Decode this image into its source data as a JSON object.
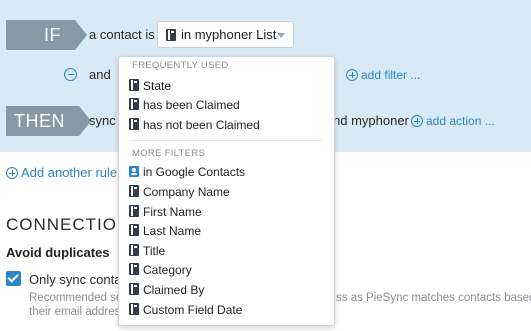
{
  "rules": {
    "if_label": "IF",
    "condition_text": "a contact is",
    "condition_select": "in myphoner List",
    "and_text": "and",
    "add_filter": "add filter ...",
    "then_label": "THEN",
    "action_text_left": "sync t",
    "action_text_right": "nd myphoner",
    "add_action": "add action ...",
    "add_rule": "Add another rule ."
  },
  "connection": {
    "title": "CONNECTION",
    "avoid_duplicates": "Avoid duplicates",
    "only_sync": "Only sync contac",
    "recommended_left": "Recommended set",
    "recommended_right": "ss as PieSync matches contacts based on",
    "email_line": "their email addres"
  },
  "dropdown": {
    "frequently_used_header": "FREQUENTLY USED",
    "frequent_items": [
      "State",
      "has been Claimed",
      "has not been Claimed"
    ],
    "more_filters_header": "MORE FILTERS",
    "more_items": [
      "in Google Contacts",
      "Company Name",
      "First Name",
      "Last Name",
      "Title",
      "Category",
      "Claimed By",
      "Custom Field Date"
    ]
  },
  "colors": {
    "panel_bg": "#d8eaf5",
    "tag_bg": "#8798a8",
    "link": "#2a86c4"
  },
  "icons": {
    "list": "doc-icon",
    "contact": "contact-icon"
  }
}
